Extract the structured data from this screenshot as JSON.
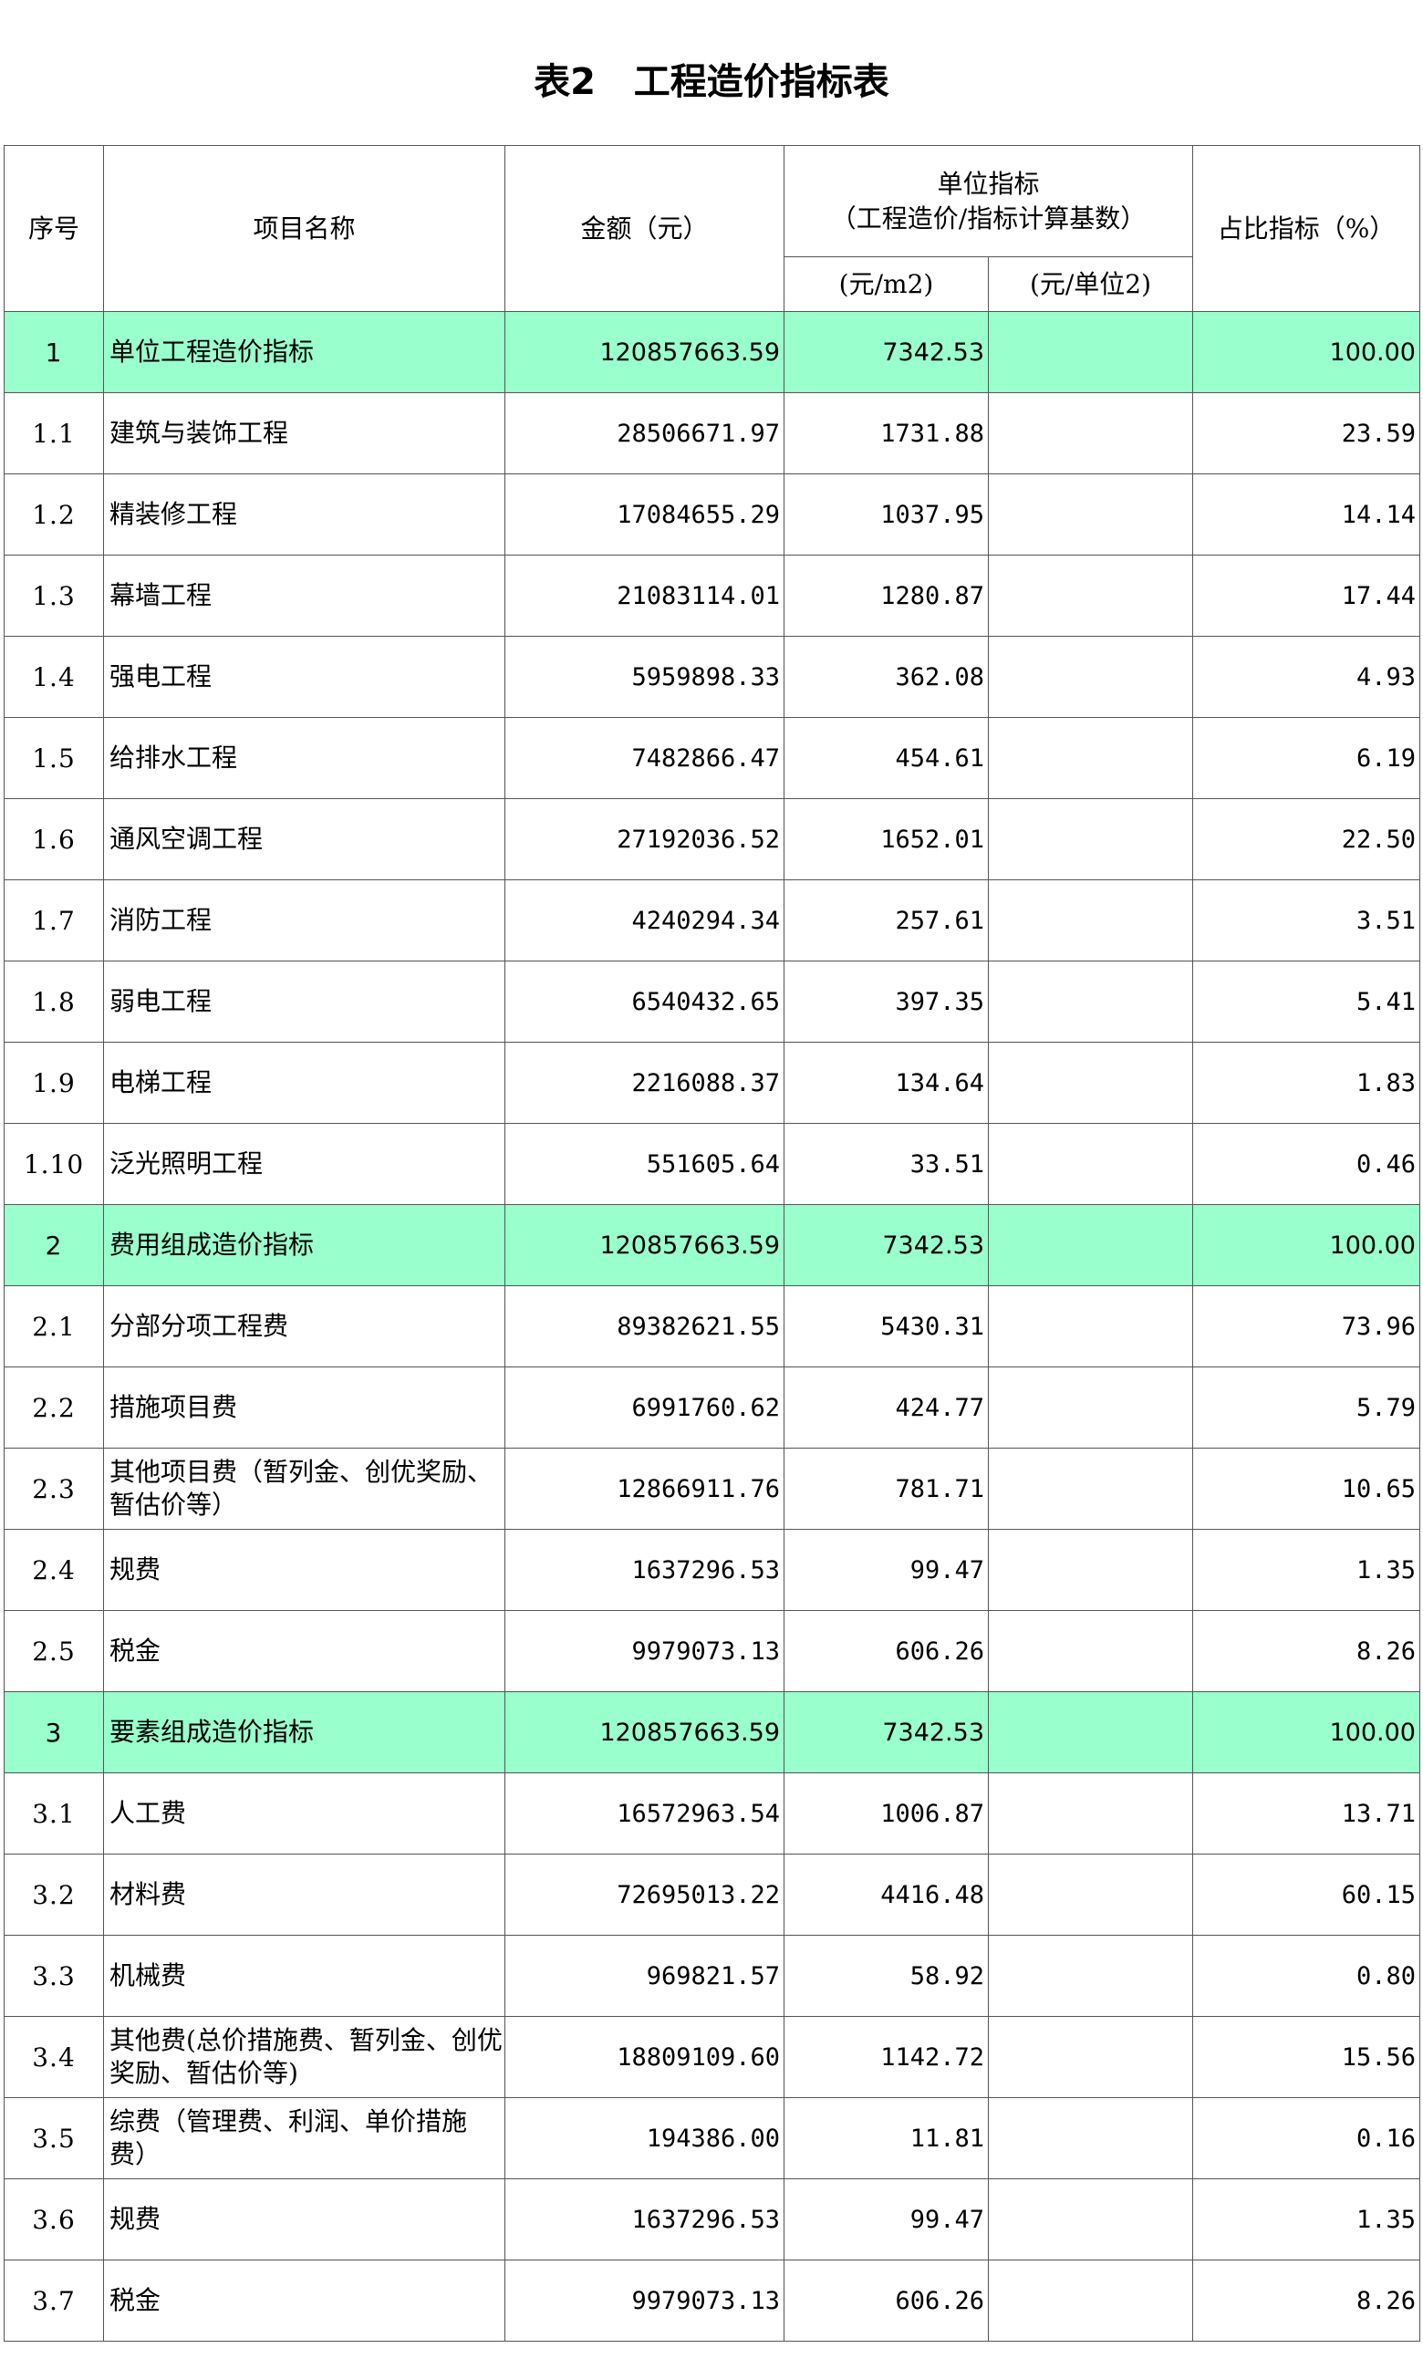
{
  "title": "表2   工程造价指标表",
  "headers": {
    "no": "序号",
    "name": "项目名称",
    "amount": "金额（元）",
    "unit_index_line1": "单位指标",
    "unit_index_line2": "（工程造价/指标计算基数）",
    "unit_m2": "(元/m2)",
    "unit_per2": "(元/单位2)",
    "ratio": "占比指标（%）"
  },
  "rows": [
    {
      "no": "1",
      "name": "单位工程造价指标",
      "amount": "120857663.59",
      "per_m2": "7342.53",
      "per_unit2": "",
      "ratio": "100.00",
      "group": true
    },
    {
      "no": "1.1",
      "name": "建筑与装饰工程",
      "amount": "28506671.97",
      "per_m2": "1731.88",
      "per_unit2": "",
      "ratio": "23.59",
      "group": false
    },
    {
      "no": "1.2",
      "name": "精装修工程",
      "amount": "17084655.29",
      "per_m2": "1037.95",
      "per_unit2": "",
      "ratio": "14.14",
      "group": false
    },
    {
      "no": "1.3",
      "name": "幕墙工程",
      "amount": "21083114.01",
      "per_m2": "1280.87",
      "per_unit2": "",
      "ratio": "17.44",
      "group": false
    },
    {
      "no": "1.4",
      "name": "强电工程",
      "amount": "5959898.33",
      "per_m2": "362.08",
      "per_unit2": "",
      "ratio": "4.93",
      "group": false
    },
    {
      "no": "1.5",
      "name": "给排水工程",
      "amount": "7482866.47",
      "per_m2": "454.61",
      "per_unit2": "",
      "ratio": "6.19",
      "group": false
    },
    {
      "no": "1.6",
      "name": "通风空调工程",
      "amount": "27192036.52",
      "per_m2": "1652.01",
      "per_unit2": "",
      "ratio": "22.50",
      "group": false
    },
    {
      "no": "1.7",
      "name": "消防工程",
      "amount": "4240294.34",
      "per_m2": "257.61",
      "per_unit2": "",
      "ratio": "3.51",
      "group": false
    },
    {
      "no": "1.8",
      "name": "弱电工程",
      "amount": "6540432.65",
      "per_m2": "397.35",
      "per_unit2": "",
      "ratio": "5.41",
      "group": false
    },
    {
      "no": "1.9",
      "name": "电梯工程",
      "amount": "2216088.37",
      "per_m2": "134.64",
      "per_unit2": "",
      "ratio": "1.83",
      "group": false
    },
    {
      "no": "1.10",
      "name": "泛光照明工程",
      "amount": "551605.64",
      "per_m2": "33.51",
      "per_unit2": "",
      "ratio": "0.46",
      "group": false
    },
    {
      "no": "2",
      "name": "费用组成造价指标",
      "amount": "120857663.59",
      "per_m2": "7342.53",
      "per_unit2": "",
      "ratio": "100.00",
      "group": true
    },
    {
      "no": "2.1",
      "name": "分部分项工程费",
      "amount": "89382621.55",
      "per_m2": "5430.31",
      "per_unit2": "",
      "ratio": "73.96",
      "group": false
    },
    {
      "no": "2.2",
      "name": "措施项目费",
      "amount": "6991760.62",
      "per_m2": "424.77",
      "per_unit2": "",
      "ratio": "5.79",
      "group": false
    },
    {
      "no": "2.3",
      "name": "其他项目费（暂列金、创优奖励、暂估价等）",
      "amount": "12866911.76",
      "per_m2": "781.71",
      "per_unit2": "",
      "ratio": "10.65",
      "group": false
    },
    {
      "no": "2.4",
      "name": "规费",
      "amount": "1637296.53",
      "per_m2": "99.47",
      "per_unit2": "",
      "ratio": "1.35",
      "group": false
    },
    {
      "no": "2.5",
      "name": "税金",
      "amount": "9979073.13",
      "per_m2": "606.26",
      "per_unit2": "",
      "ratio": "8.26",
      "group": false
    },
    {
      "no": "3",
      "name": "要素组成造价指标",
      "amount": "120857663.59",
      "per_m2": "7342.53",
      "per_unit2": "",
      "ratio": "100.00",
      "group": true
    },
    {
      "no": "3.1",
      "name": "人工费",
      "amount": "16572963.54",
      "per_m2": "1006.87",
      "per_unit2": "",
      "ratio": "13.71",
      "group": false
    },
    {
      "no": "3.2",
      "name": "材料费",
      "amount": "72695013.22",
      "per_m2": "4416.48",
      "per_unit2": "",
      "ratio": "60.15",
      "group": false
    },
    {
      "no": "3.3",
      "name": "机械费",
      "amount": "969821.57",
      "per_m2": "58.92",
      "per_unit2": "",
      "ratio": "0.80",
      "group": false
    },
    {
      "no": "3.4",
      "name": "其他费(总价措施费、暂列金、创优奖励、暂估价等)",
      "amount": "18809109.60",
      "per_m2": "1142.72",
      "per_unit2": "",
      "ratio": "15.56",
      "group": false
    },
    {
      "no": "3.5",
      "name": "综费（管理费、利润、单价措施费）",
      "amount": "194386.00",
      "per_m2": "11.81",
      "per_unit2": "",
      "ratio": "0.16",
      "group": false
    },
    {
      "no": "3.6",
      "name": "规费",
      "amount": "1637296.53",
      "per_m2": "99.47",
      "per_unit2": "",
      "ratio": "1.35",
      "group": false
    },
    {
      "no": "3.7",
      "name": "税金",
      "amount": "9979073.13",
      "per_m2": "606.26",
      "per_unit2": "",
      "ratio": "8.26",
      "group": false
    }
  ],
  "colors": {
    "group_row_bg": "#99ffcc",
    "border": "#555555"
  }
}
